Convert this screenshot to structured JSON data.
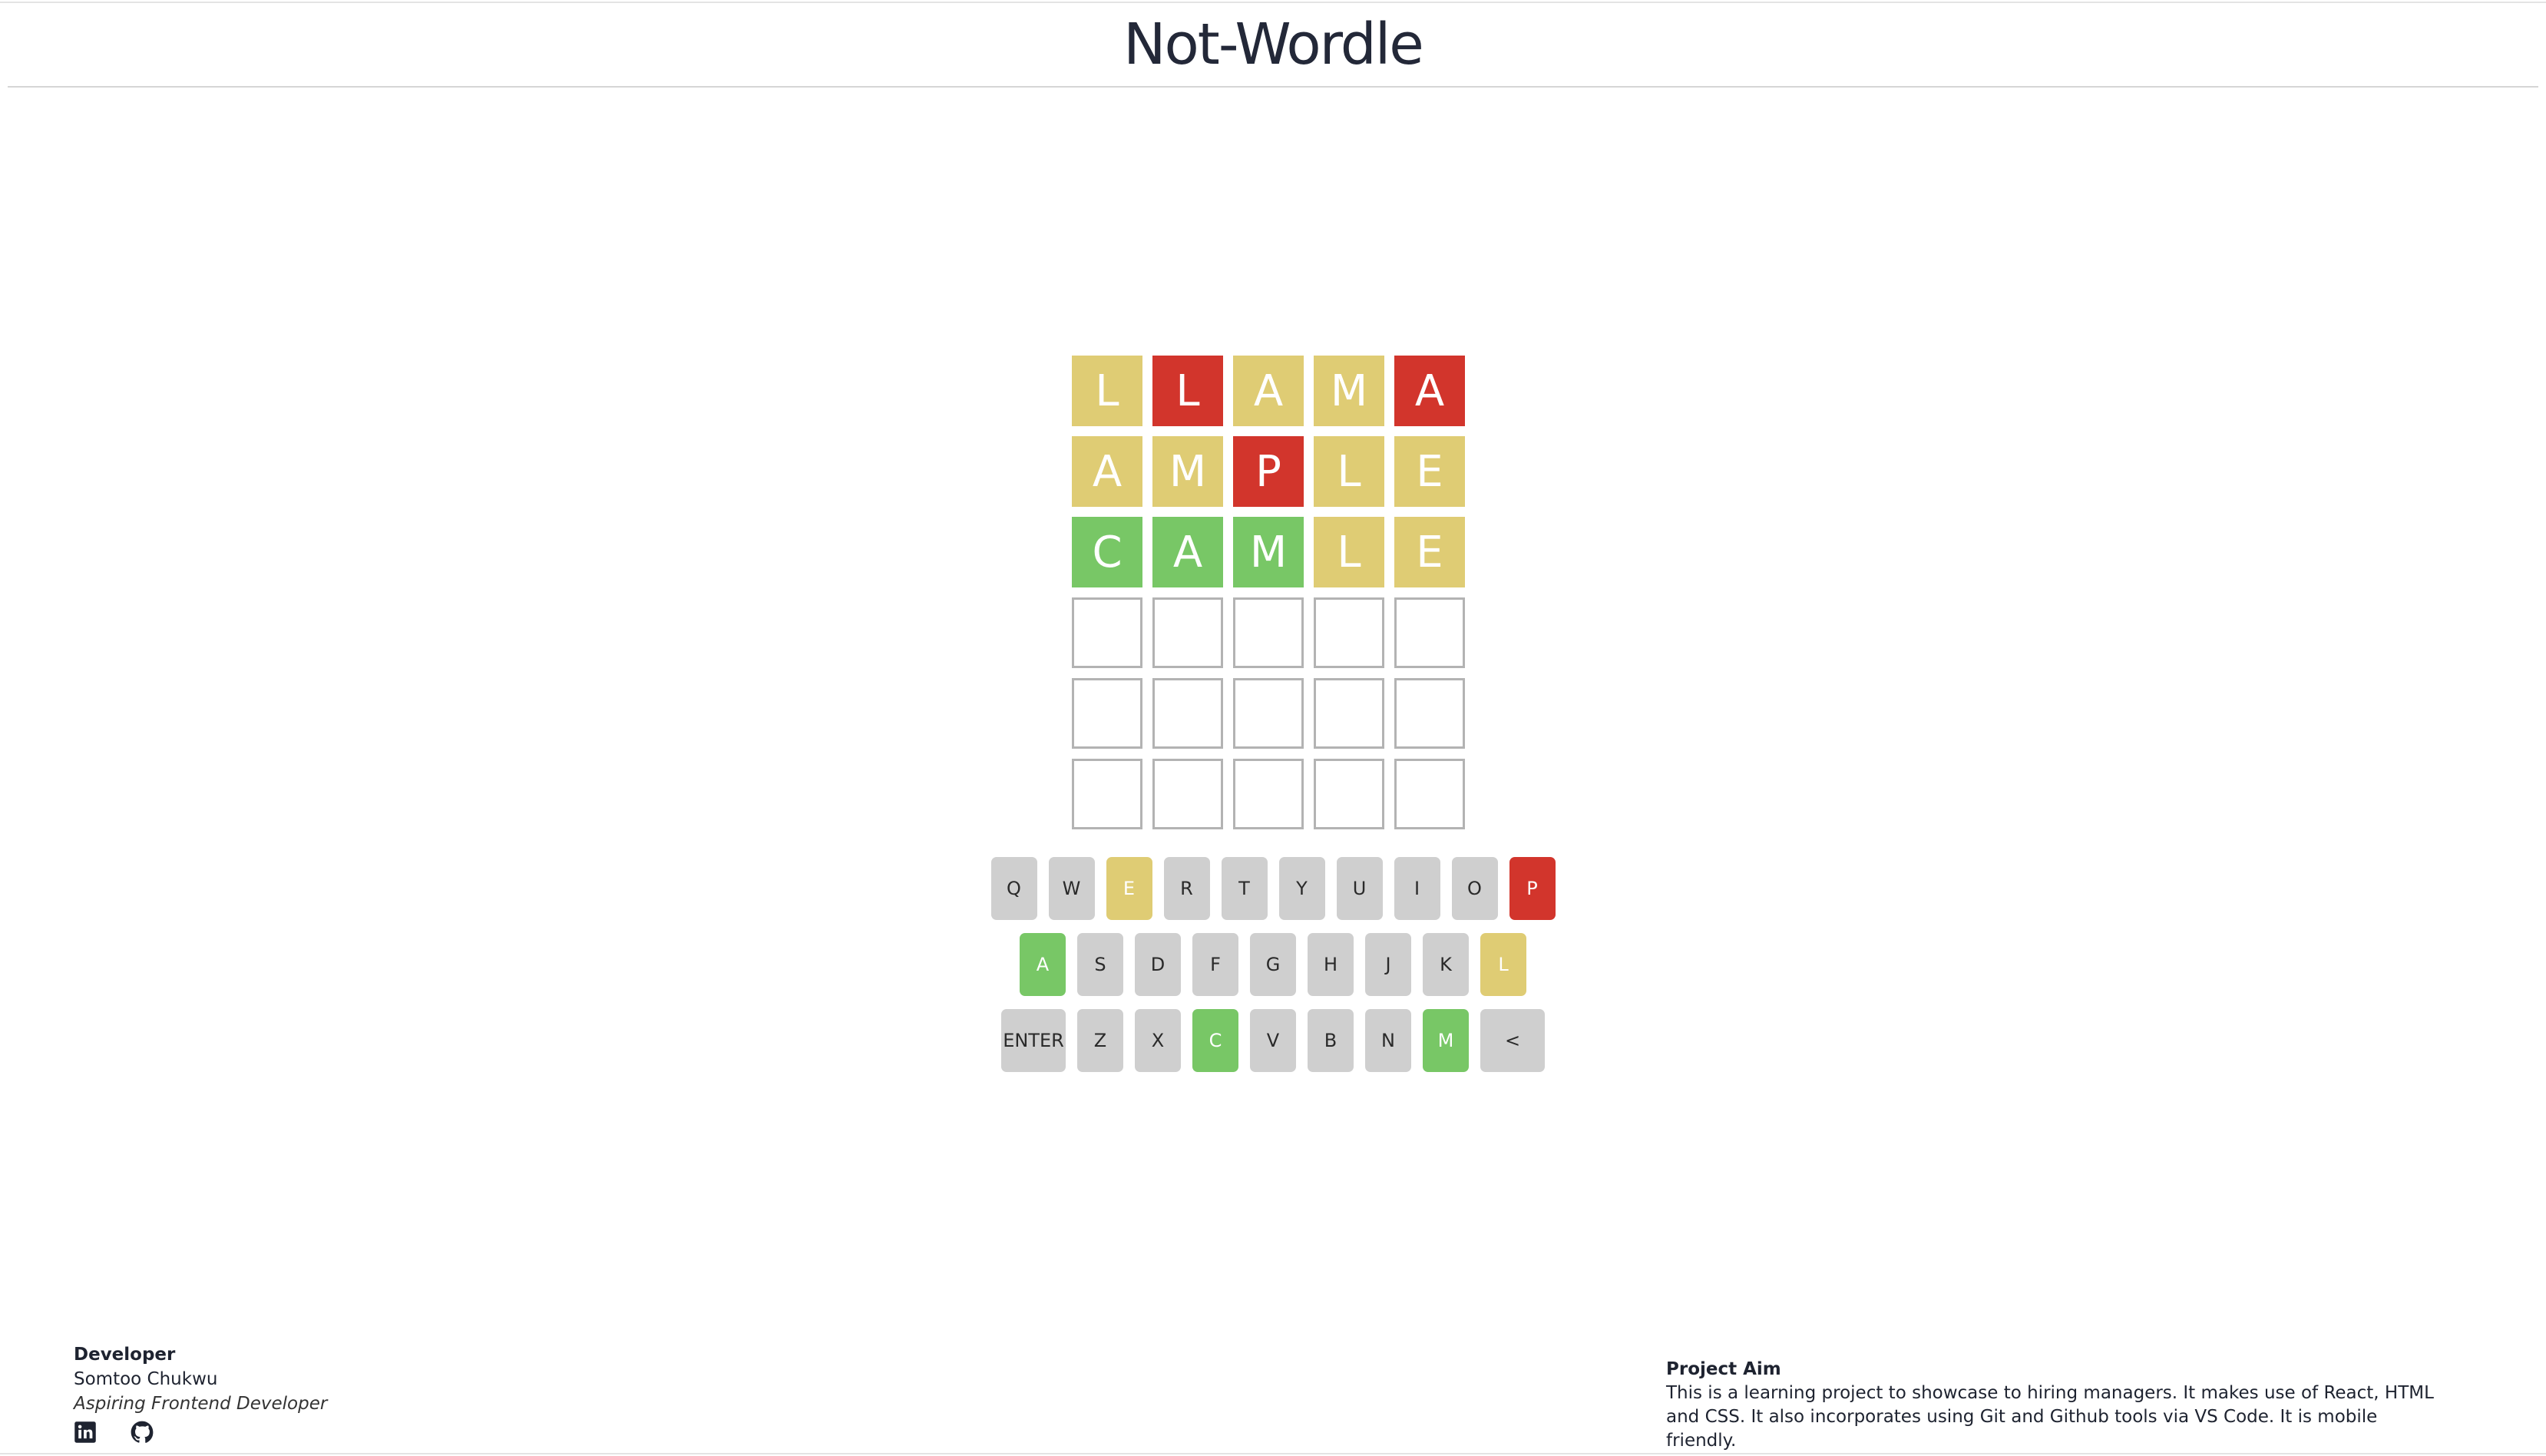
{
  "header": {
    "title": "Not-Wordle"
  },
  "board": {
    "rows": [
      [
        {
          "letter": "L",
          "state": "yellow"
        },
        {
          "letter": "L",
          "state": "red"
        },
        {
          "letter": "A",
          "state": "yellow"
        },
        {
          "letter": "M",
          "state": "yellow"
        },
        {
          "letter": "A",
          "state": "red"
        }
      ],
      [
        {
          "letter": "A",
          "state": "yellow"
        },
        {
          "letter": "M",
          "state": "yellow"
        },
        {
          "letter": "P",
          "state": "red"
        },
        {
          "letter": "L",
          "state": "yellow"
        },
        {
          "letter": "E",
          "state": "yellow"
        }
      ],
      [
        {
          "letter": "C",
          "state": "green"
        },
        {
          "letter": "A",
          "state": "green"
        },
        {
          "letter": "M",
          "state": "green"
        },
        {
          "letter": "L",
          "state": "yellow"
        },
        {
          "letter": "E",
          "state": "yellow"
        }
      ],
      [
        {
          "letter": "",
          "state": "empty"
        },
        {
          "letter": "",
          "state": "empty"
        },
        {
          "letter": "",
          "state": "empty"
        },
        {
          "letter": "",
          "state": "empty"
        },
        {
          "letter": "",
          "state": "empty"
        }
      ],
      [
        {
          "letter": "",
          "state": "empty"
        },
        {
          "letter": "",
          "state": "empty"
        },
        {
          "letter": "",
          "state": "empty"
        },
        {
          "letter": "",
          "state": "empty"
        },
        {
          "letter": "",
          "state": "empty"
        }
      ],
      [
        {
          "letter": "",
          "state": "empty"
        },
        {
          "letter": "",
          "state": "empty"
        },
        {
          "letter": "",
          "state": "empty"
        },
        {
          "letter": "",
          "state": "empty"
        },
        {
          "letter": "",
          "state": "empty"
        }
      ]
    ]
  },
  "keyboard": {
    "rows": [
      [
        {
          "label": "Q",
          "state": "default"
        },
        {
          "label": "W",
          "state": "default"
        },
        {
          "label": "E",
          "state": "yellow"
        },
        {
          "label": "R",
          "state": "default"
        },
        {
          "label": "T",
          "state": "default"
        },
        {
          "label": "Y",
          "state": "default"
        },
        {
          "label": "U",
          "state": "default"
        },
        {
          "label": "I",
          "state": "default"
        },
        {
          "label": "O",
          "state": "default"
        },
        {
          "label": "P",
          "state": "red"
        }
      ],
      [
        {
          "label": "A",
          "state": "green"
        },
        {
          "label": "S",
          "state": "default"
        },
        {
          "label": "D",
          "state": "default"
        },
        {
          "label": "F",
          "state": "default"
        },
        {
          "label": "G",
          "state": "default"
        },
        {
          "label": "H",
          "state": "default"
        },
        {
          "label": "J",
          "state": "default"
        },
        {
          "label": "K",
          "state": "default"
        },
        {
          "label": "L",
          "state": "yellow"
        }
      ],
      [
        {
          "label": "ENTER",
          "state": "default",
          "wide": true
        },
        {
          "label": "Z",
          "state": "default"
        },
        {
          "label": "X",
          "state": "default"
        },
        {
          "label": "C",
          "state": "green"
        },
        {
          "label": "V",
          "state": "default"
        },
        {
          "label": "B",
          "state": "default"
        },
        {
          "label": "N",
          "state": "default"
        },
        {
          "label": "M",
          "state": "green"
        },
        {
          "label": "<",
          "state": "default",
          "wide": true
        }
      ]
    ]
  },
  "colors": {
    "yellow": "#dfcc74",
    "green": "#78c766",
    "red": "#d2352c",
    "key_default": "#cfcfcf"
  },
  "developer": {
    "heading": "Developer",
    "name": "Somtoo Chukwu",
    "tagline": "Aspiring Frontend Developer",
    "icons": [
      "linkedin-icon",
      "github-icon"
    ]
  },
  "project_aim": {
    "heading": "Project Aim",
    "text": "This is a learning project to showcase to hiring managers. It makes use of React, HTML and CSS. It also incorporates using Git and Github tools via VS Code. It is mobile friendly."
  }
}
